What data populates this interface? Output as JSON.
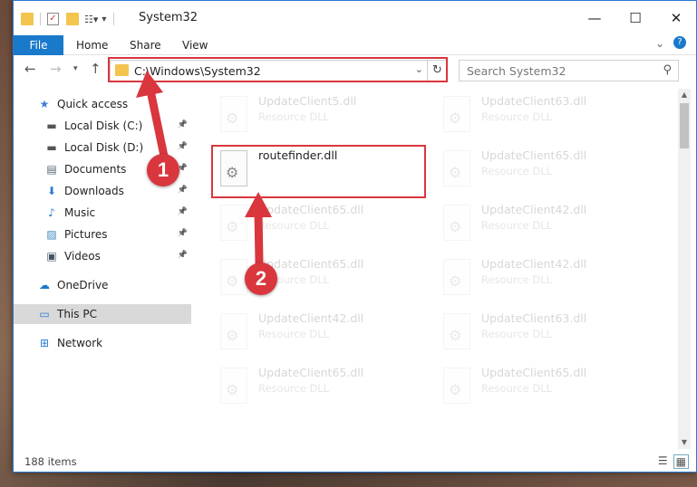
{
  "window": {
    "title": "System32",
    "minimize": "—",
    "maximize": "☐",
    "close": "✕"
  },
  "ribbon": {
    "tabs": [
      "File",
      "Home",
      "Share",
      "View"
    ],
    "collapse": "⌄",
    "help": "?"
  },
  "address": {
    "path": "C:\\Windows\\System32",
    "search_placeholder": "Search System32"
  },
  "sidebar": {
    "items": [
      {
        "label": "Quick access",
        "icon": "star-icon",
        "pinned": false
      },
      {
        "label": "Local Disk (C:)",
        "icon": "drive-icon",
        "pinned": true
      },
      {
        "label": "Local Disk (D:)",
        "icon": "drive-icon",
        "pinned": true
      },
      {
        "label": "Documents",
        "icon": "document-icon",
        "pinned": true
      },
      {
        "label": "Downloads",
        "icon": "download-icon",
        "pinned": true
      },
      {
        "label": "Music",
        "icon": "music-icon",
        "pinned": true
      },
      {
        "label": "Pictures",
        "icon": "pictures-icon",
        "pinned": true
      },
      {
        "label": "Videos",
        "icon": "videos-icon",
        "pinned": true
      },
      {
        "label": "OneDrive",
        "icon": "cloud-icon",
        "pinned": false
      },
      {
        "label": "This PC",
        "icon": "computer-icon",
        "pinned": false,
        "selected": true
      },
      {
        "label": "Network",
        "icon": "network-icon",
        "pinned": false
      }
    ]
  },
  "files": {
    "left": [
      {
        "name": "UpdateClient5.dll",
        "type": "Resource DLL",
        "faded": true
      },
      {
        "name": "routefinder.dll",
        "type": "",
        "faded": false
      },
      {
        "name": "UpdateClient65.dll",
        "type": "Resource DLL",
        "faded": true
      },
      {
        "name": "UpdateClient65.dll",
        "type": "Resource DLL",
        "faded": true
      },
      {
        "name": "UpdateClient42.dll",
        "type": "Resource DLL",
        "faded": true
      },
      {
        "name": "UpdateClient65.dll",
        "type": "Resource DLL",
        "faded": true
      }
    ],
    "right": [
      {
        "name": "UpdateClient63.dll",
        "type": "Resource DLL",
        "faded": true
      },
      {
        "name": "UpdateClient65.dll",
        "type": "Resource DLL",
        "faded": true
      },
      {
        "name": "UpdateClient42.dll",
        "type": "Resource DLL",
        "faded": true
      },
      {
        "name": "UpdateClient42.dll",
        "type": "Resource DLL",
        "faded": true
      },
      {
        "name": "UpdateClient63.dll",
        "type": "Resource DLL",
        "faded": true
      },
      {
        "name": "UpdateClient65.dll",
        "type": "Resource DLL",
        "faded": true
      }
    ]
  },
  "status": {
    "item_count": "188 items"
  },
  "annotations": {
    "step1": "1",
    "step2": "2",
    "color": "#d9363e"
  }
}
